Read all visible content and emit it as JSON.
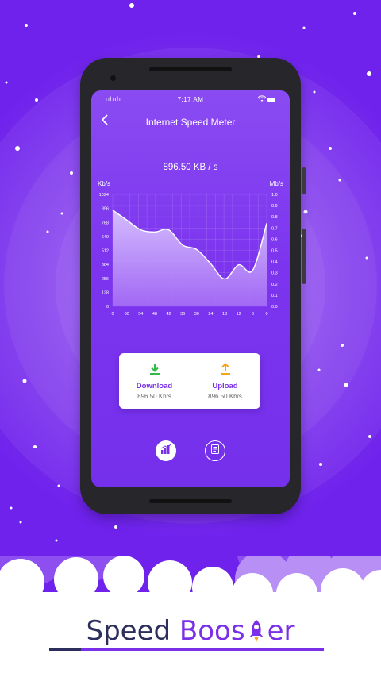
{
  "status": {
    "time": "7:17 AM"
  },
  "header": {
    "title": "Internet Speed Meter"
  },
  "meter": {
    "current_speed": "896.50 KB / s"
  },
  "chart_data": {
    "type": "area",
    "left_axis_label": "Kb/s",
    "right_axis_label": "Mb/s",
    "left_ticks": [
      "1024",
      "896",
      "768",
      "640",
      "512",
      "384",
      "256",
      "128",
      "0"
    ],
    "right_ticks": [
      "1.0",
      "0.9",
      "0.8",
      "0.7",
      "0.6",
      "0.5",
      "0.4",
      "0.3",
      "0.2",
      "0.1",
      "0.0"
    ],
    "x_ticks": [
      "0",
      "60",
      "54",
      "48",
      "42",
      "36",
      "30",
      "24",
      "18",
      "12",
      "6",
      "0"
    ],
    "ylim": [
      0,
      1024
    ],
    "x": [
      0,
      6,
      12,
      18,
      24,
      30,
      36,
      42,
      48,
      54,
      60,
      66
    ],
    "values": [
      880,
      790,
      700,
      680,
      700,
      560,
      520,
      390,
      250,
      380,
      330,
      760
    ],
    "grid": true,
    "colors": {
      "line": "#ffffff",
      "fill_top": "#d9c3ff",
      "fill_bottom": "#a66ef5"
    }
  },
  "stats": {
    "download": {
      "label": "Download",
      "value": "896.50 Kb/s",
      "color": "#35b84a"
    },
    "upload": {
      "label": "Upload",
      "value": "896.50 Kb/s",
      "color": "#f2a51d"
    }
  },
  "brand": {
    "word1": "Speed",
    "word2_start": "Boos",
    "word2_end": "er"
  },
  "icons": {
    "back": "chevron-left-icon",
    "stats": "bar-chart-icon",
    "history": "document-list-icon",
    "rocket": "rocket-icon"
  }
}
